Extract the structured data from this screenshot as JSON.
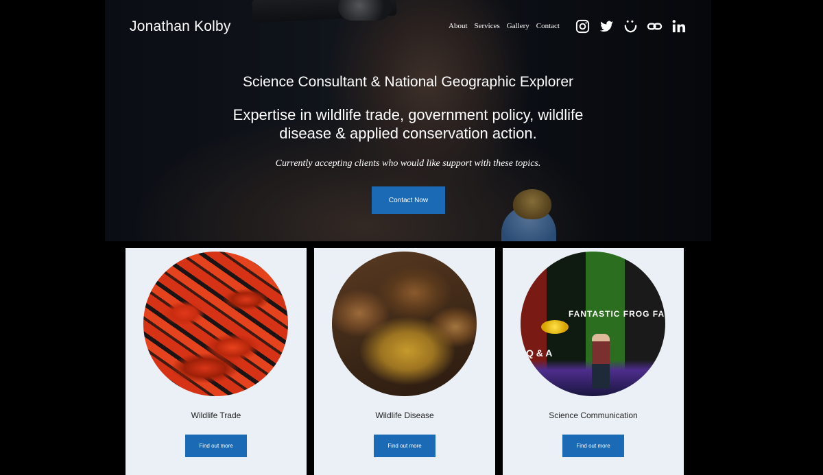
{
  "header": {
    "brand": "Jonathan Kolby",
    "nav": [
      "About",
      "Services",
      "Gallery",
      "Contact"
    ],
    "socials": [
      "instagram-icon",
      "twitter-icon",
      "smugmug-icon",
      "link-icon",
      "linkedin-icon"
    ]
  },
  "hero": {
    "subtitle": "Science Consultant & National Geographic Explorer",
    "headline": "Expertise in wildlife trade, government policy, wildlife disease & applied conservation action.",
    "note": "Currently accepting clients who would like support with these topics.",
    "cta": "Contact Now"
  },
  "cards": [
    {
      "title": "Wildlife Trade",
      "button": "Find out more"
    },
    {
      "title": "Wildlife Disease",
      "button": "Find out more"
    },
    {
      "title": "Science Communication",
      "button": "Find out more"
    }
  ],
  "photo_text": {
    "stage_title": "FANTASTIC FROG FA",
    "stage_qa": "Q & A"
  },
  "colors": {
    "accent": "#1a6ab6",
    "card_bg": "#eaf0f6"
  }
}
